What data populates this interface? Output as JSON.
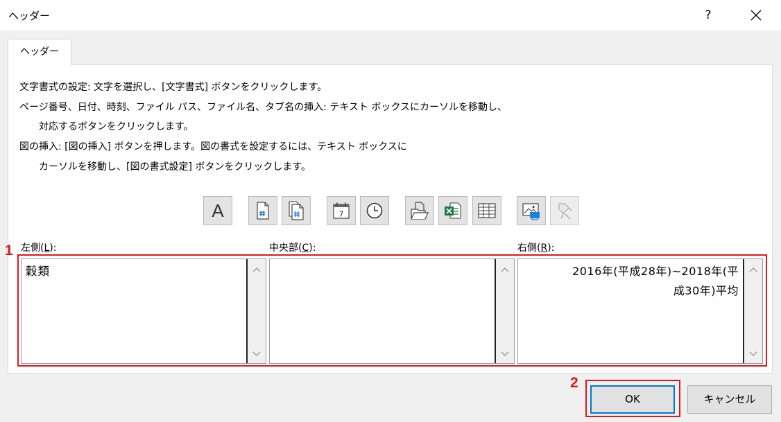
{
  "window": {
    "title": "ヘッダー",
    "help_label": "?"
  },
  "tab": {
    "label": "ヘッダー"
  },
  "instructions": {
    "line1": "文字書式の設定: 文字を選択し、[文字書式] ボタンをクリックします。",
    "line2": "ページ番号、日付、時刻、ファイル パス、ファイル名、タブ名の挿入: テキスト ボックスにカーソルを移動し、",
    "line3": "対応するボタンをクリックします。",
    "line4": "図の挿入: [図の挿入] ボタンを押します。図の書式を設定するには、テキスト ボックスに",
    "line5": "カーソルを移動し、[図の書式設定] ボタンをクリックします。"
  },
  "toolbar": {
    "format_text_label": "A",
    "date_label": "7",
    "icons": [
      "format-text-icon",
      "page-number-icon",
      "number-of-pages-icon",
      "date-icon",
      "time-icon",
      "file-path-icon",
      "file-name-icon",
      "sheet-name-icon",
      "insert-picture-icon",
      "format-picture-icon"
    ]
  },
  "sections": {
    "left": {
      "label_prefix": "左側(",
      "access_key": "L",
      "label_suffix": "):",
      "value": "穀類"
    },
    "center": {
      "label_prefix": "中央部(",
      "access_key": "C",
      "label_suffix": "):",
      "value": ""
    },
    "right": {
      "label_prefix": "右側(",
      "access_key": "R",
      "label_suffix": "):",
      "line1": "2016年(平成28年)~2018年(平",
      "line2": "成30年)平均"
    }
  },
  "annotations": {
    "step1": "1",
    "step2": "2",
    "color": "#e0161a"
  },
  "buttons": {
    "ok": "OK",
    "cancel": "キャンセル"
  }
}
